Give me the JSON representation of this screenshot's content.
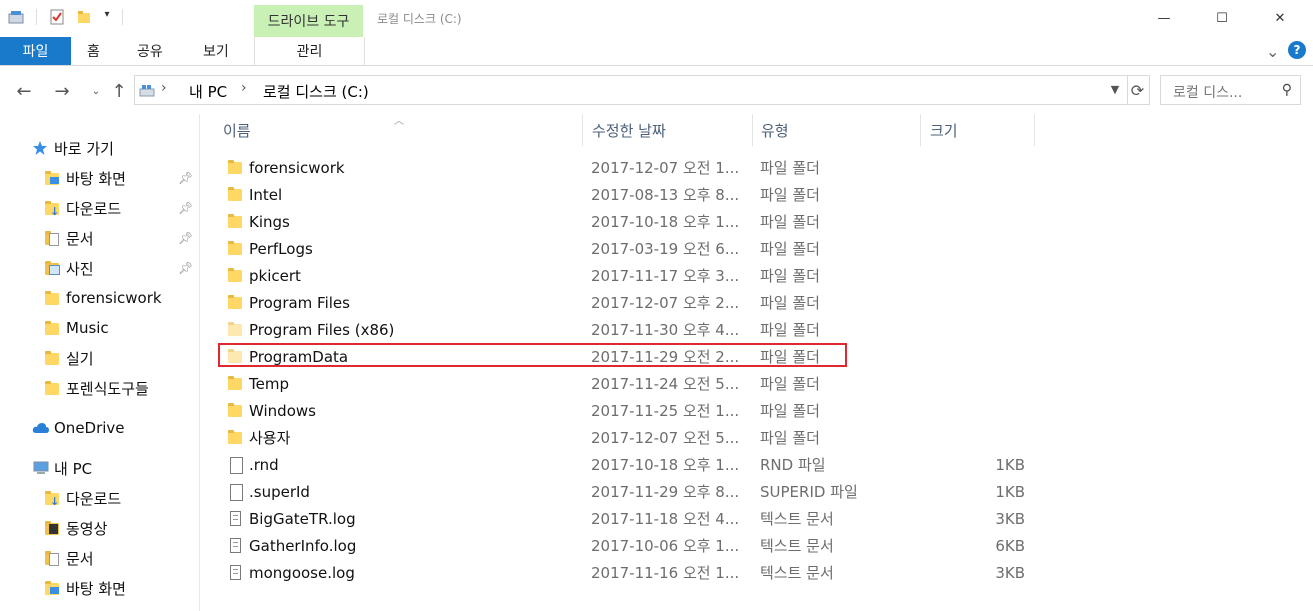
{
  "window": {
    "title": "로컬 디스크 (C:)",
    "context_tab": "드라이브 도구",
    "minimize_glyph": "—",
    "maximize_glyph": "☐",
    "close_glyph": "✕"
  },
  "ribbon": {
    "file": "파일",
    "home": "홈",
    "share": "공유",
    "view": "보기",
    "manage": "관리",
    "expand_glyph": "⌄",
    "help_glyph": "?"
  },
  "address": {
    "breadcrumb": [
      "내 PC",
      "로컬 디스크 (C:)"
    ],
    "separator": "›",
    "search_placeholder": "로컬 디스..."
  },
  "sidebar": {
    "quick_access": "바로 가기",
    "quick_items": [
      {
        "label": "바탕 화면",
        "icon": "desktop-folder-icon",
        "pinned": true
      },
      {
        "label": "다운로드",
        "icon": "downloads-folder-icon",
        "pinned": true
      },
      {
        "label": "문서",
        "icon": "documents-folder-icon",
        "pinned": true
      },
      {
        "label": "사진",
        "icon": "pictures-folder-icon",
        "pinned": true
      },
      {
        "label": "forensicwork",
        "icon": "folder-icon",
        "pinned": false
      },
      {
        "label": "Music",
        "icon": "folder-icon",
        "pinned": false
      },
      {
        "label": "실기",
        "icon": "folder-icon",
        "pinned": false
      },
      {
        "label": "포렌식도구들",
        "icon": "folder-icon",
        "pinned": false
      }
    ],
    "onedrive": "OneDrive",
    "this_pc": "내 PC",
    "pc_items": [
      {
        "label": "다운로드",
        "icon": "downloads-folder-icon"
      },
      {
        "label": "동영상",
        "icon": "videos-folder-icon"
      },
      {
        "label": "문서",
        "icon": "documents-folder-icon"
      },
      {
        "label": "바탕 화면",
        "icon": "desktop-folder-icon"
      }
    ]
  },
  "columns": {
    "name": "이름",
    "date": "수정한 날짜",
    "type": "유형",
    "size": "크기"
  },
  "files": [
    {
      "name": "forensicwork",
      "date": "2017-12-07 오전 1...",
      "type": "파일 폴더",
      "size": "",
      "icon": "folder"
    },
    {
      "name": "Intel",
      "date": "2017-08-13 오후 8...",
      "type": "파일 폴더",
      "size": "",
      "icon": "folder"
    },
    {
      "name": "Kings",
      "date": "2017-10-18 오후 1...",
      "type": "파일 폴더",
      "size": "",
      "icon": "folder"
    },
    {
      "name": "PerfLogs",
      "date": "2017-03-19 오전 6...",
      "type": "파일 폴더",
      "size": "",
      "icon": "folder"
    },
    {
      "name": "pkicert",
      "date": "2017-11-17 오후 3...",
      "type": "파일 폴더",
      "size": "",
      "icon": "folder"
    },
    {
      "name": "Program Files",
      "date": "2017-12-07 오후 2...",
      "type": "파일 폴더",
      "size": "",
      "icon": "folder"
    },
    {
      "name": "Program Files (x86)",
      "date": "2017-11-30 오후 4...",
      "type": "파일 폴더",
      "size": "",
      "icon": "folder-light"
    },
    {
      "name": "ProgramData",
      "date": "2017-11-29 오전 2...",
      "type": "파일 폴더",
      "size": "",
      "icon": "folder-light"
    },
    {
      "name": "Temp",
      "date": "2017-11-24 오전 5...",
      "type": "파일 폴더",
      "size": "",
      "icon": "folder"
    },
    {
      "name": "Windows",
      "date": "2017-11-25 오전 1...",
      "type": "파일 폴더",
      "size": "",
      "icon": "folder"
    },
    {
      "name": "사용자",
      "date": "2017-12-07 오전 5...",
      "type": "파일 폴더",
      "size": "",
      "icon": "folder"
    },
    {
      "name": ".rnd",
      "date": "2017-10-18 오후 1...",
      "type": "RND 파일",
      "size": "1KB",
      "icon": "file"
    },
    {
      "name": ".superId",
      "date": "2017-11-29 오후 8...",
      "type": "SUPERID 파일",
      "size": "1KB",
      "icon": "file"
    },
    {
      "name": "BigGateTR.log",
      "date": "2017-11-18 오전 4...",
      "type": "텍스트 문서",
      "size": "3KB",
      "icon": "text"
    },
    {
      "name": "GatherInfo.log",
      "date": "2017-10-06 오후 1...",
      "type": "텍스트 문서",
      "size": "6KB",
      "icon": "text"
    },
    {
      "name": "mongoose.log",
      "date": "2017-11-16 오전 1...",
      "type": "텍스트 문서",
      "size": "3KB",
      "icon": "text"
    }
  ],
  "highlighted_row": "ProgramData",
  "colors": {
    "file_tab": "#1979ca",
    "context_tab": "#c9f0b5",
    "highlight_border": "#e0282e",
    "folder": "#ffd765"
  }
}
